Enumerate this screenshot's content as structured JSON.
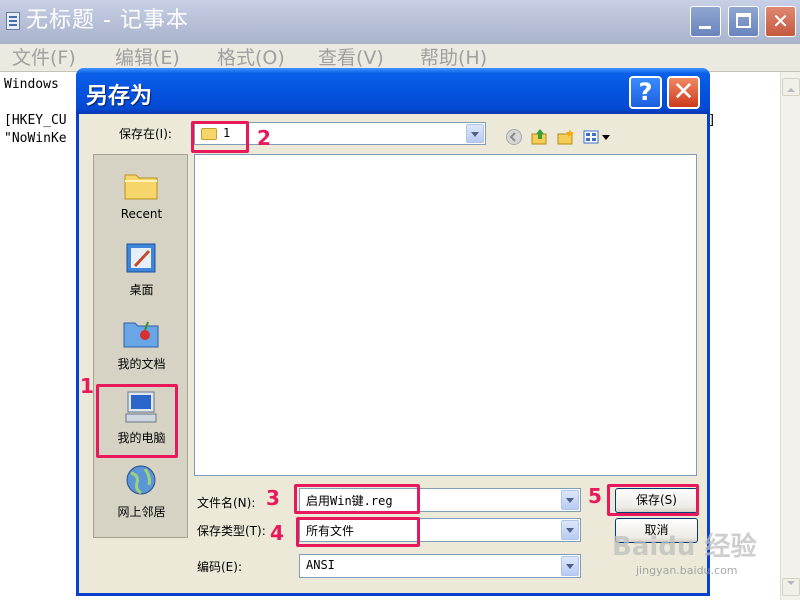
{
  "notepad": {
    "title": "无标题 - 记事本",
    "menu": [
      "文件(F)",
      "编辑(E)",
      "格式(O)",
      "查看(V)",
      "帮助(H)"
    ],
    "text_lines": [
      "Windows",
      "",
      "[HKEY_CU",
      "\"NoWinKe"
    ],
    "right_fragment": "]"
  },
  "dialog": {
    "title": "另存为",
    "help": "?",
    "close": "✕",
    "save_in_label": "保存在(I):",
    "save_in_value": "1",
    "places": [
      "Recent",
      "桌面",
      "我的文档",
      "我的电脑",
      "网上邻居"
    ],
    "filename_label": "文件名(N):",
    "filename_value": "启用Win键.reg",
    "filetype_label": "保存类型(T):",
    "filetype_value": "所有文件",
    "encoding_label": "编码(E):",
    "encoding_value": "ANSI",
    "save_button": "保存(S)",
    "cancel_button": "取消"
  },
  "markers": [
    "1",
    "2",
    "3",
    "4",
    "5"
  ],
  "watermark": {
    "brand": "Baidu 经验",
    "url": "jingyan.baidu.com"
  },
  "colors": {
    "marker": "#e8195a",
    "dialog_title": "#0454e0",
    "dialog_bg": "#ece9d8"
  }
}
